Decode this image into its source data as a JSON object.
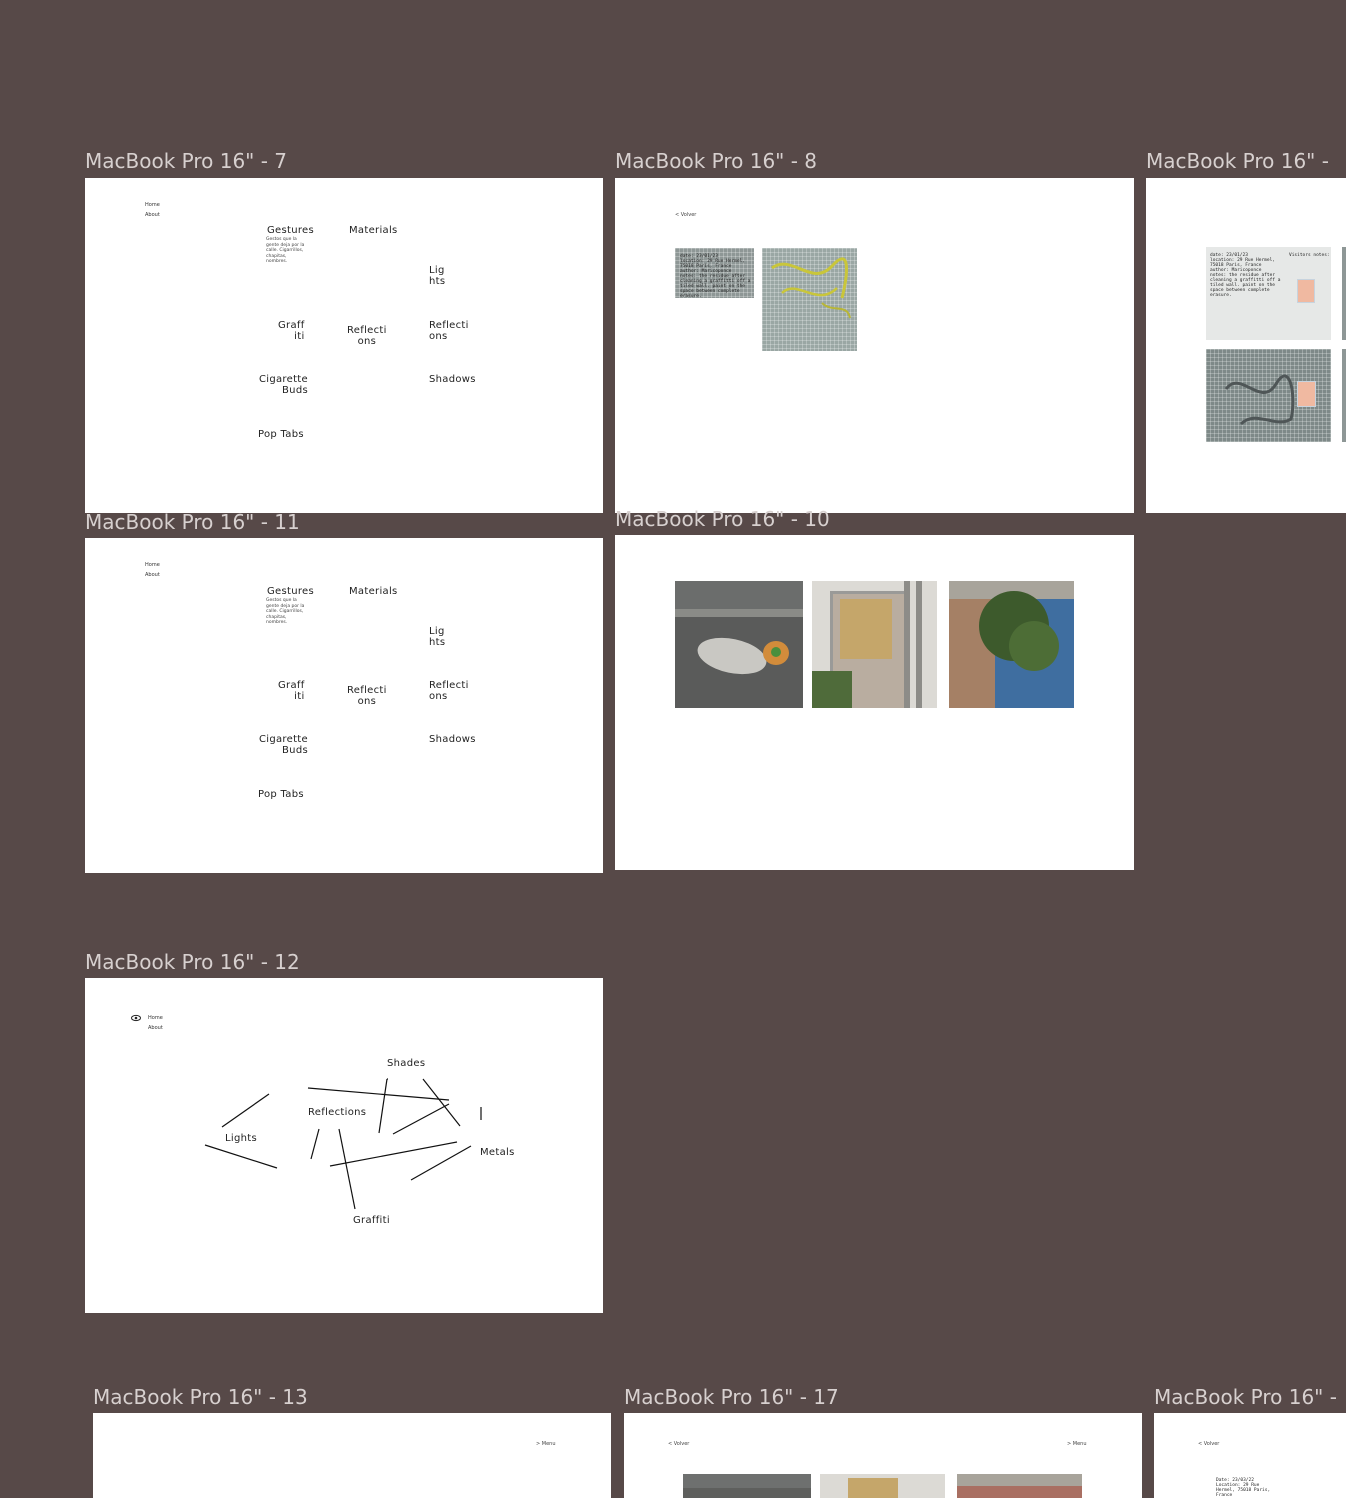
{
  "canvas": {
    "background": "#574948",
    "label_color": "#d7d0cf"
  },
  "frames": {
    "f7": {
      "label": "MacBook Pro 16\" - 7",
      "nav": [
        "Home",
        "About"
      ],
      "words": {
        "gestures": "Gestures",
        "gestures_desc": "Gestos que la\ngente deja por la\ncalle. Cigarrillos,\nchapitas,\nnombres.",
        "materials": "Materials",
        "lights": "Lig\nhts",
        "graffiti": "Graff\niti",
        "reflections_mid": "Reflecti\nons",
        "reflections_right": "Reflecti\nons",
        "cigarette": "Cigarette\nBuds",
        "shadows": "Shadows",
        "poptabs": "Pop Tabs"
      }
    },
    "f8": {
      "label": "MacBook Pro 16\" - 8",
      "back": "< Volver",
      "note": "date: 23/01/23\nlocation: 29 Rue Hermel,\n75018 Paris, France\nauthor: Maricoponce\nnotes: the residue after\ncleaning a graffitti off a\ntiled wall. paint on the\nspace between complete\nerasure."
    },
    "f9": {
      "label": "MacBook Pro 16\" -",
      "note": "date: 23/01/23\nlocation: 29 Rue Hermel,\n75018 Paris, France\nauthor: Maricoponce\nnotes: the residue after\ncleaning a graffitti off a\ntiled wall. paint on the\nspace between complete\nerasure.",
      "visitors": "Visitors notes:"
    },
    "f11": {
      "label": "MacBook Pro 16\" - 11",
      "nav": [
        "Home",
        "About"
      ],
      "words": {
        "gestures": "Gestures",
        "gestures_desc": "Gestos que la\ngente deja por la\ncalle. Cigarrillos,\nchapitas,\nnombres.",
        "materials": "Materials",
        "lights": "Lig\nhts",
        "graffiti": "Graff\niti",
        "reflections_mid": "Reflecti\nons",
        "reflections_right": "Reflecti\nons",
        "cigarette": "Cigarette\nBuds",
        "shadows": "Shadows",
        "poptabs": "Pop Tabs"
      }
    },
    "f10": {
      "label": "MacBook Pro 16\" - 10"
    },
    "f12": {
      "label": "MacBook Pro 16\" - 12",
      "nav": [
        "Home",
        "About"
      ],
      "words": {
        "shades": "Shades",
        "reflections": "Reflections",
        "lights": "Lights",
        "metals": "Metals",
        "graffiti": "Graffiti"
      }
    },
    "f13": {
      "label": "MacBook Pro 16\" - 13",
      "menu": "> Menu"
    },
    "f17": {
      "label": "MacBook Pro 16\" - 17",
      "back": "< Volver",
      "menu": "> Menu"
    },
    "f18": {
      "label": "MacBook Pro 16\" -",
      "back": "< Volver",
      "note": "Date: 23/03/22\nLocation: 29 Rue\nHermel, 75018 Paris,\nFrance"
    }
  }
}
